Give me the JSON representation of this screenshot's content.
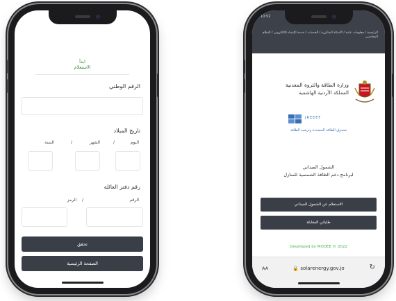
{
  "left_phone": {
    "heading_line1": "ابدأ",
    "heading_line2": "الاستعلام",
    "national_id_label": "الرقم الوطني",
    "dob_label": "تاريخ الميلاد",
    "day_label": "اليوم",
    "month_label": "الشهر",
    "year_label": "السنة",
    "separator": "/",
    "family_book_label": "رقم دفتر العائلة",
    "number_label": "الرقم",
    "code_label": "الرمز",
    "verify_button": "تحقق",
    "home_button": "الصفحة الرئيسية"
  },
  "right_phone": {
    "status_time": "10:52",
    "breadcrumb": "الرئيسية / معلومات عامة / الأسئلة المتكررة / الخدمات / خدمة الإنشاء الالكتروني / النظام المحاسبي",
    "ministry_name": "وزارة الطاقة والثروة المعدنية",
    "kingdom_name": "المملكة الأردنية الهاشمية",
    "fund_abbr": "JREEEF",
    "fund_name": "صندوق الطاقة المتجددة وترشيد الطاقة",
    "program_line1": "الشمول الميداني",
    "program_line2": "لبرنامج دعم الطاقة الشمسية للمنازل",
    "inquiry_button": "الاستعلام عن الشمول الميداني",
    "requests_button": "طلباتي المقابلة",
    "footer": "Developed by MODEE © 2022",
    "aa_label": "AA",
    "url": "solarenergy.gov.jo",
    "lock_icon": "lock-icon",
    "reload_icon": "reload-icon"
  }
}
